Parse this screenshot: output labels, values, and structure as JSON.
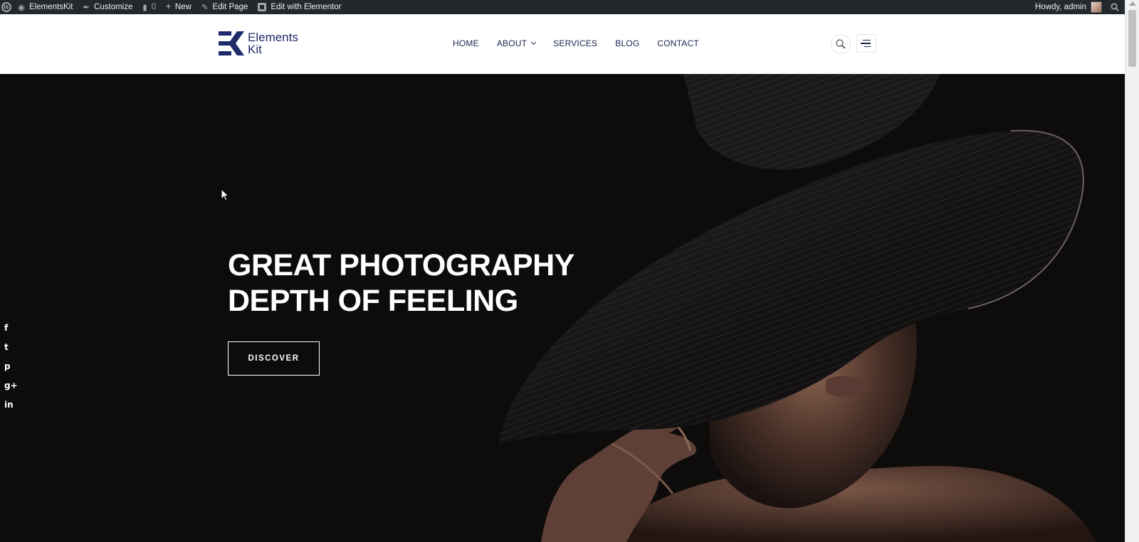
{
  "admin_bar": {
    "site_name": "ElementsKit",
    "customize": "Customize",
    "comments_count": "0",
    "new": "New",
    "edit_page": "Edit Page",
    "edit_elementor": "Edit with Elementor",
    "howdy": "Howdy, admin"
  },
  "header": {
    "logo_line1": "Elements",
    "logo_line2": "Kit",
    "nav": [
      "HOME",
      "ABOUT",
      "SERVICES",
      "BLOG",
      "CONTACT"
    ]
  },
  "hero": {
    "headline_line1": "GREAT PHOTOGRAPHY",
    "headline_line2": "DEPTH OF FEELING",
    "cta_label": "DISCOVER"
  },
  "social": [
    "f",
    "t",
    "p",
    "g+",
    "in"
  ],
  "colors": {
    "brand_navy": "#1f2a6b",
    "admin_bar": "#23282d",
    "hero_bg": "#0e0b0b"
  }
}
